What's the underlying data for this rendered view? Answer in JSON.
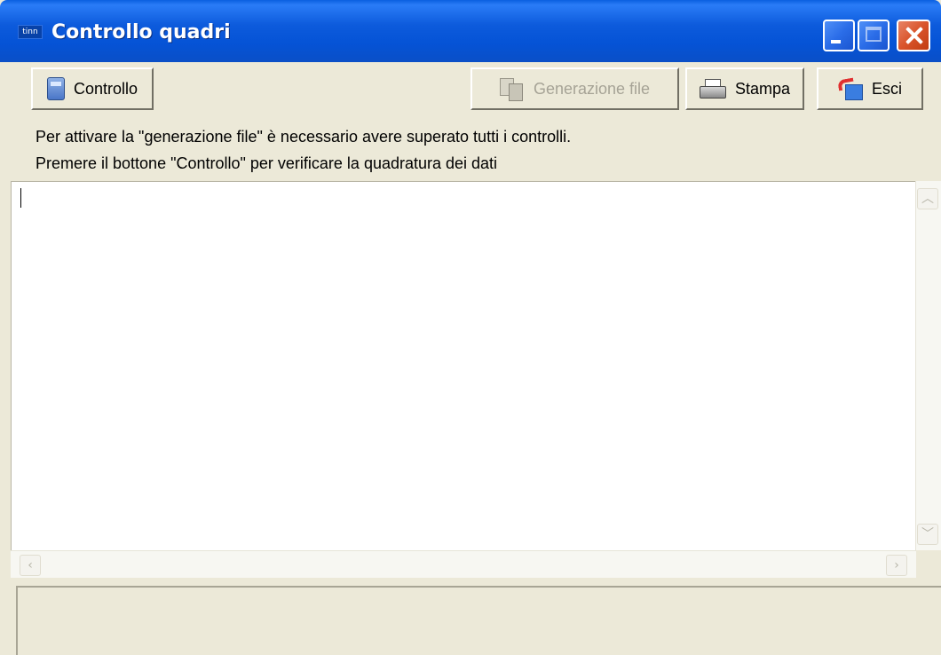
{
  "window": {
    "app_icon_text": "tinn",
    "title": "Controllo quadri"
  },
  "toolbar": {
    "controllo": {
      "label": "Controllo",
      "icon": "calculator-icon",
      "enabled": true
    },
    "generazione": {
      "label": "Generazione file",
      "icon": "file-generate-icon",
      "enabled": false
    },
    "stampa": {
      "label": "Stampa",
      "icon": "printer-icon",
      "enabled": true
    },
    "esci": {
      "label": "Esci",
      "icon": "exit-icon",
      "enabled": true
    }
  },
  "info": {
    "line1": "Per attivare la \"generazione file\" è necessario avere superato tutti i controlli.",
    "line2": "Premere il bottone \"Controllo\"  per verificare la quadratura dei dati"
  },
  "output": {
    "text": ""
  },
  "status": {
    "text": ""
  }
}
